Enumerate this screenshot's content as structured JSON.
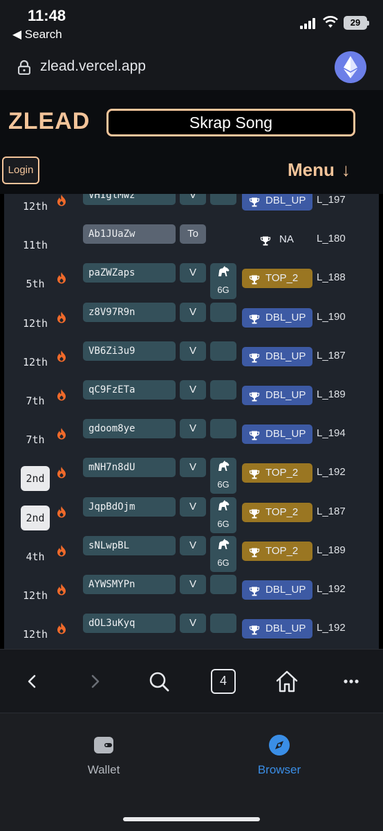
{
  "status_bar": {
    "time": "11:48",
    "back_app": "◀ Search",
    "battery": "29"
  },
  "url_bar": {
    "url": "zlead.vercel.app"
  },
  "app": {
    "logo": "ZLEAD",
    "song_title": "Skrap Song",
    "login_label": "Login",
    "menu_label": "Menu",
    "menu_arrow": "↓"
  },
  "rows": [
    {
      "rank": "12th",
      "code": "VHIglMwz",
      "v": "V",
      "slot": "",
      "badge": "DBL_UP",
      "level": "L_197",
      "partial_top": true
    },
    {
      "rank": "11th",
      "code": "Ab1JUaZw",
      "v": "To",
      "slot": null,
      "badge": "NA",
      "level": "L_180"
    },
    {
      "rank": "5th",
      "code": "paZWZaps",
      "v": "V",
      "slot": "6G",
      "badge": "TOP_2",
      "level": "L_188"
    },
    {
      "rank": "12th",
      "code": "z8V97R9n",
      "v": "V",
      "slot": "",
      "badge": "DBL_UP",
      "level": "L_190"
    },
    {
      "rank": "12th",
      "code": "VB6Zi3u9",
      "v": "V",
      "slot": "",
      "badge": "DBL_UP",
      "level": "L_187"
    },
    {
      "rank": "7th",
      "code": "qC9FzETa",
      "v": "V",
      "slot": "",
      "badge": "DBL_UP",
      "level": "L_189"
    },
    {
      "rank": "7th",
      "code": "gdoom8ye",
      "v": "V",
      "slot": "",
      "badge": "DBL_UP",
      "level": "L_194"
    },
    {
      "rank": "2nd",
      "code": "mNH7n8dU",
      "v": "V",
      "slot": "6G",
      "badge": "TOP_2",
      "level": "L_192",
      "highlight": true
    },
    {
      "rank": "2nd",
      "code": "JqpBdOjm",
      "v": "V",
      "slot": "6G",
      "badge": "TOP_2",
      "level": "L_187",
      "highlight": true
    },
    {
      "rank": "4th",
      "code": "sNLwpBL",
      "v": "V",
      "slot": "6G",
      "badge": "TOP_2",
      "level": "L_189"
    },
    {
      "rank": "12th",
      "code": "AYWSMYPn",
      "v": "V",
      "slot": "",
      "badge": "DBL_UP",
      "level": "L_192"
    },
    {
      "rank": "12th",
      "code": "dOL3uKyq",
      "v": "V",
      "slot": "",
      "badge": "DBL_UP",
      "level": "L_192"
    }
  ],
  "browser_nav": {
    "back_icon": "chevron-left-icon",
    "forward_icon": "chevron-right-icon",
    "search_icon": "search-icon",
    "tab_count": "4",
    "home_icon": "home-icon",
    "more_icon": "more-icon"
  },
  "tabbar": {
    "wallet_label": "Wallet",
    "browser_label": "Browser",
    "active_color": "#3a8ee6"
  },
  "colors": {
    "accent": "#f3c49a",
    "dbl_badge": "#3d5aa4",
    "top_badge": "#9a7622",
    "fire": "#f06a2a"
  }
}
